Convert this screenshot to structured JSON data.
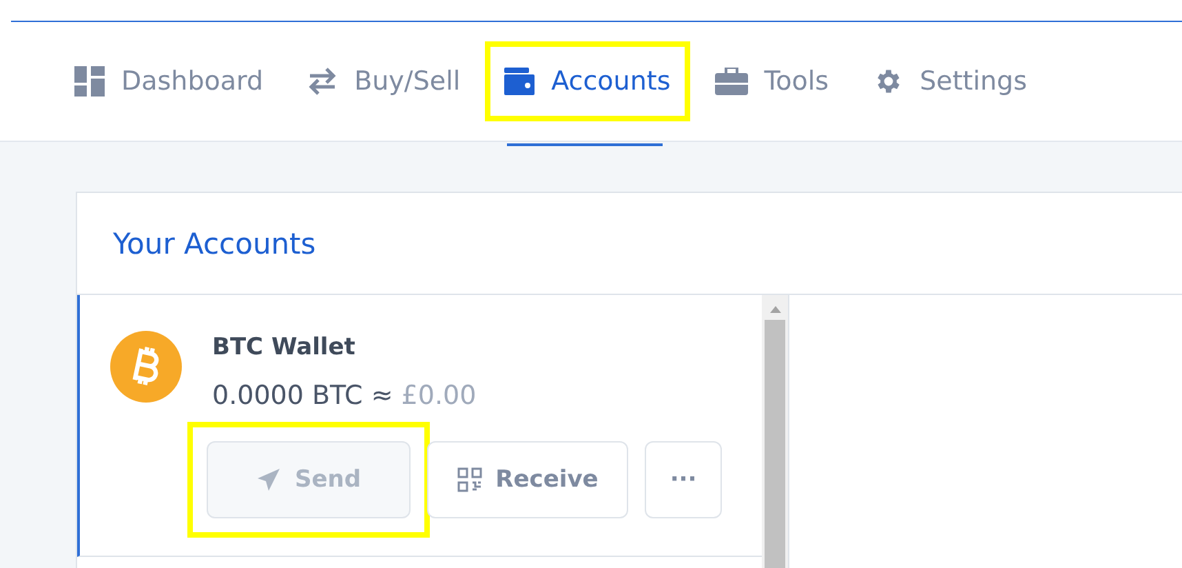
{
  "nav": {
    "tabs": [
      {
        "label": "Dashboard",
        "kind": "dashboard",
        "selected": false,
        "highlighted": false
      },
      {
        "label": "Buy/Sell",
        "kind": "exchange",
        "selected": false,
        "highlighted": false
      },
      {
        "label": "Accounts",
        "kind": "wallet",
        "selected": true,
        "highlighted": true
      },
      {
        "label": "Tools",
        "kind": "tools",
        "selected": false,
        "highlighted": false
      },
      {
        "label": "Settings",
        "kind": "settings",
        "selected": false,
        "highlighted": false
      }
    ]
  },
  "accounts": {
    "title": "Your Accounts",
    "items": [
      {
        "name": "BTC Wallet",
        "amount": "0.0000 BTC ≈",
        "fiat": "£0.00",
        "selected": true,
        "buttons": [
          {
            "label": "Send",
            "kind": "send",
            "disabled": true,
            "highlighted": true
          },
          {
            "label": "Receive",
            "kind": "receive",
            "disabled": false,
            "highlighted": false
          },
          {
            "label": "···",
            "kind": "more",
            "disabled": false,
            "highlighted": false
          }
        ]
      }
    ]
  }
}
